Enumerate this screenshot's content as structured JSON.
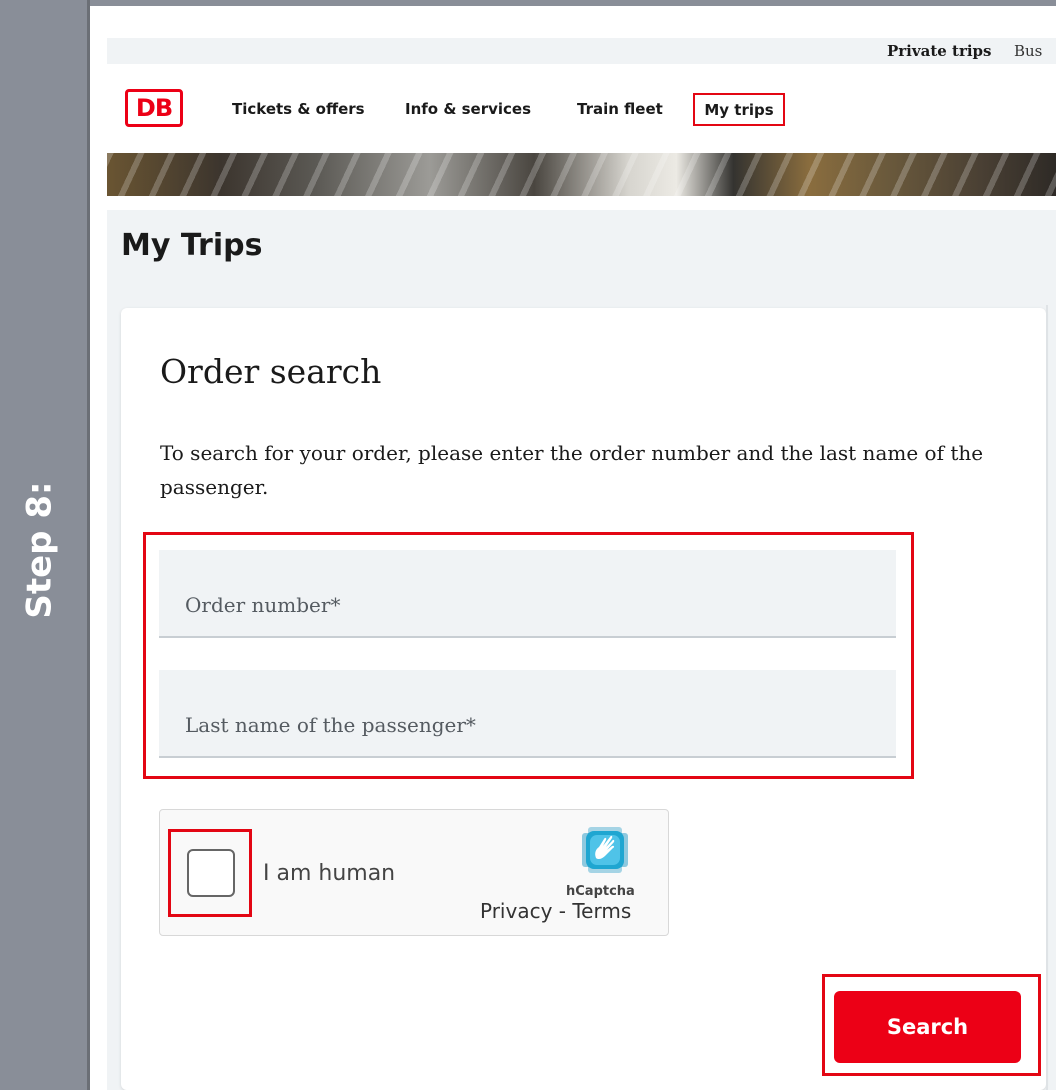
{
  "step": {
    "label": "Step 8:"
  },
  "utility_bar": {
    "private_trips": "Private trips",
    "business": "Bus"
  },
  "header": {
    "logo": "DB",
    "nav": {
      "tickets": "Tickets & offers",
      "info": "Info & services",
      "fleet": "Train fleet",
      "my_trips": "My trips"
    }
  },
  "page": {
    "title": "My Trips"
  },
  "order_search": {
    "title": "Order search",
    "intro": "To search for your order, please enter the order number and the last name of the passenger.",
    "order_number": {
      "placeholder": "Order number*",
      "value": ""
    },
    "last_name": {
      "placeholder": "Last name of the passenger*",
      "value": ""
    },
    "search_label": "Search"
  },
  "captcha": {
    "label": "I am human",
    "brand": "hCaptcha",
    "links": "Privacy - Terms",
    "checked": false
  },
  "colors": {
    "brand_red": "#ec0016",
    "highlight_red": "#e30613",
    "step_bar": "#898e98",
    "page_bg": "#f0f3f5",
    "hcaptcha_teal": "#0074bf"
  },
  "icons": {
    "captcha_logo": "hcaptcha-hand-icon"
  }
}
